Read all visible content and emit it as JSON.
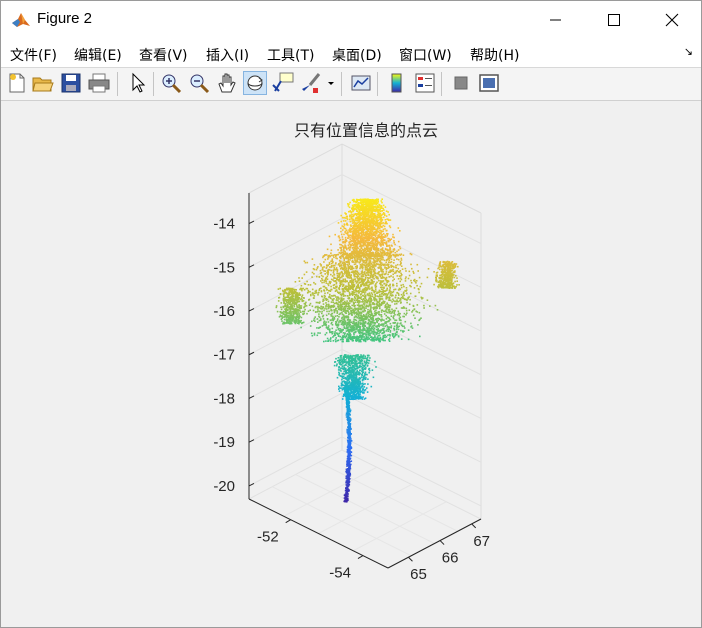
{
  "window": {
    "title": "Figure 2"
  },
  "menu": [
    "文件(F)",
    "编辑(E)",
    "查看(V)",
    "插入(I)",
    "工具(T)",
    "桌面(D)",
    "窗口(W)",
    "帮助(H)"
  ],
  "toolbar": {
    "buttons": [
      {
        "name": "new-figure",
        "icon": "new-file-icon"
      },
      {
        "name": "open-file",
        "icon": "folder-open-icon"
      },
      {
        "name": "save-figure",
        "icon": "save-icon"
      },
      {
        "name": "print-figure",
        "icon": "printer-icon"
      },
      {
        "name": "edit-plot",
        "icon": "pointer-arrow-icon"
      },
      {
        "name": "zoom-in",
        "icon": "zoom-in-icon"
      },
      {
        "name": "zoom-out",
        "icon": "zoom-out-icon"
      },
      {
        "name": "pan",
        "icon": "hand-icon"
      },
      {
        "name": "rotate-3d",
        "icon": "rotate-3d-icon",
        "active": true
      },
      {
        "name": "data-cursor",
        "icon": "data-tip-icon"
      },
      {
        "name": "brush",
        "icon": "brush-icon"
      },
      {
        "name": "link-plot",
        "icon": "link-plot-icon"
      },
      {
        "name": "insert-colorbar",
        "icon": "colorbar-icon"
      },
      {
        "name": "insert-legend",
        "icon": "legend-icon"
      },
      {
        "name": "hide-plot-tools",
        "icon": "hide-tools-icon"
      },
      {
        "name": "show-plot-tools",
        "icon": "plot-tools-icon"
      }
    ]
  },
  "axes": {
    "title": "只有位置信息的点云",
    "z_ticks": [
      "-14",
      "-15",
      "-16",
      "-17",
      "-18",
      "-19",
      "-20"
    ],
    "x_ticks": [
      "-52",
      "-54"
    ],
    "y_ticks": [
      "65",
      "66",
      "67"
    ]
  },
  "chart_data": {
    "type": "scatter",
    "title": "只有位置信息的点云",
    "xlabel": "",
    "ylabel": "",
    "zlabel": "",
    "zlim": [
      -20.3,
      -13.3
    ],
    "z_tick_values": [
      -14,
      -15,
      -16,
      -17,
      -18,
      -19,
      -20
    ],
    "colormap": "parula",
    "colormap_colors": [
      "#3e26a8",
      "#2d6df4",
      "#14b1d4",
      "#3dc583",
      "#b9c03b",
      "#f5b93c",
      "#f9f90f"
    ],
    "grid": true,
    "view": "3d",
    "description_points": "dense tree-shaped point cloud; thin trunk from z≈-20.2 up to z≈-17.7, crown up to z≈-13.1"
  }
}
